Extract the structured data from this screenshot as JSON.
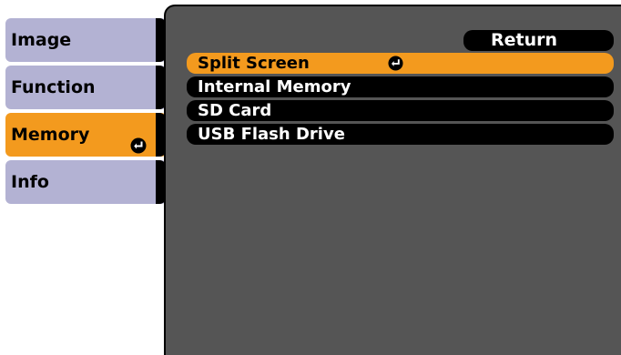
{
  "sidebar": {
    "tabs": [
      {
        "label": "Image"
      },
      {
        "label": "Function"
      },
      {
        "label": "Memory"
      },
      {
        "label": "Info"
      }
    ]
  },
  "main": {
    "return_label": "Return",
    "items": [
      {
        "label": "Split Screen"
      },
      {
        "label": "Internal Memory"
      },
      {
        "label": "SD Card"
      },
      {
        "label": "USB Flash Drive"
      }
    ]
  },
  "colors": {
    "accent": "#f39a1e",
    "tab_inactive": "#b3b2d3",
    "panel_bg": "#555555"
  },
  "icons": {
    "enter": "enter-icon"
  }
}
